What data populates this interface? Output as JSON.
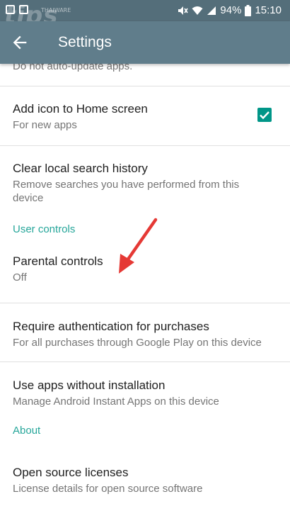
{
  "status_bar": {
    "watermark": "tips",
    "watermark_small": "THAIWARE",
    "battery": "94%",
    "time": "15:10"
  },
  "app_bar": {
    "title": "Settings"
  },
  "settings": {
    "partial_item": {
      "subtitle": "Do not auto-update apps."
    },
    "add_icon": {
      "title": "Add icon to Home screen",
      "subtitle": "For new apps",
      "checked": true
    },
    "clear_history": {
      "title": "Clear local search history",
      "subtitle": "Remove searches you have performed from this device"
    },
    "user_controls_header": "User controls",
    "parental_controls": {
      "title": "Parental controls",
      "subtitle": "Off"
    },
    "require_auth": {
      "title": "Require authentication for purchases",
      "subtitle": "For all purchases through Google Play on this device"
    },
    "instant_apps": {
      "title": "Use apps without installation",
      "subtitle": "Manage Android Instant Apps on this device"
    },
    "about_header": "About",
    "open_source": {
      "title": "Open source licenses",
      "subtitle": "License details for open source software"
    }
  },
  "colors": {
    "status_bar": "#546e7a",
    "app_bar": "#607d8b",
    "accent": "#009688",
    "section_header": "#26a69a",
    "annotation_arrow": "#e53935"
  },
  "icons": [
    "gallery-icon",
    "cast-icon",
    "mute-icon",
    "wifi-icon",
    "signal-icon",
    "battery-icon",
    "back-arrow-icon",
    "check-icon"
  ]
}
